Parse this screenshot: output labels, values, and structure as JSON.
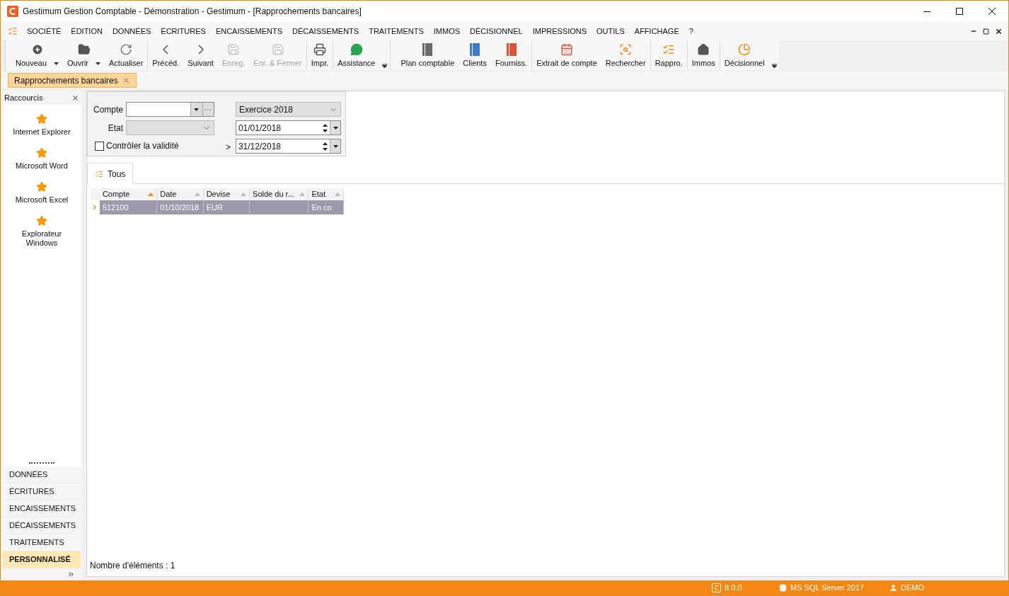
{
  "window": {
    "title": "Gestimum Gestion Comptable - Démonstration - Gestimum - [Rapprochements bancaires]"
  },
  "menu": [
    "SOCIÉTÉ",
    "ÉDITION",
    "DONNÉES",
    "ÉCRITURES",
    "ENCAISSEMENTS",
    "DÉCAISSEMENTS",
    "TRAITEMENTS",
    "IMMOS",
    "DÉCISIONNEL",
    "IMPRESSIONS",
    "OUTILS",
    "AFFICHAGE",
    "?"
  ],
  "toolbars": [
    {
      "groups": [
        [
          {
            "label": "Nouveau",
            "kind": "plus",
            "disabled": false,
            "dropdown": true
          },
          {
            "label": "Ouvrir",
            "kind": "folder",
            "disabled": false,
            "dropdown": true
          },
          {
            "label": "Actualiser",
            "kind": "refresh",
            "disabled": false,
            "dropdown": false
          }
        ],
        [
          {
            "label": "Précéd.",
            "kind": "prev",
            "disabled": false,
            "dropdown": false
          },
          {
            "label": "Suivant",
            "kind": "next",
            "disabled": false,
            "dropdown": false
          },
          {
            "label": "Enreg.",
            "kind": "save",
            "disabled": true,
            "dropdown": false
          },
          {
            "label": "Enr. & Fermer",
            "kind": "saveclose",
            "disabled": true,
            "dropdown": false
          }
        ],
        [
          {
            "label": "Impr.",
            "kind": "print",
            "disabled": false,
            "dropdown": false
          }
        ],
        [
          {
            "label": "Assistance",
            "kind": "chat",
            "disabled": false,
            "dropdown": false
          }
        ]
      ]
    },
    {
      "groups": [
        [
          {
            "label": "Plan comptable",
            "kind": "book-gray",
            "disabled": false,
            "dropdown": false
          },
          {
            "label": "Clients",
            "kind": "book-blue",
            "disabled": false,
            "dropdown": false
          },
          {
            "label": "Fourniss.",
            "kind": "book-red",
            "disabled": false,
            "dropdown": false
          }
        ],
        [
          {
            "label": "Extrait de compte",
            "kind": "calendar",
            "disabled": false,
            "dropdown": false
          },
          {
            "label": "Rechercher",
            "kind": "search",
            "disabled": false,
            "dropdown": false
          }
        ],
        [
          {
            "label": "Rappro.",
            "kind": "check",
            "disabled": false,
            "dropdown": false
          }
        ],
        [
          {
            "label": "Immos",
            "kind": "home",
            "disabled": false,
            "dropdown": false
          }
        ],
        [
          {
            "label": "Décisionnel",
            "kind": "pie",
            "disabled": false,
            "dropdown": false
          }
        ]
      ]
    }
  ],
  "doc_tabs": [
    {
      "label": "Rapprochements bancaires",
      "selected": true
    }
  ],
  "sidebar": {
    "title": "Raccourcis",
    "shortcuts": [
      "Internet Explorer",
      "Microsoft Word",
      "Microsoft Excel",
      "Explorateur Windows"
    ],
    "sections": [
      {
        "label": "DONNÉES",
        "selected": false
      },
      {
        "label": "ÉCRITURES",
        "selected": false
      },
      {
        "label": "ENCAISSEMENTS",
        "selected": false
      },
      {
        "label": "DÉCAISSEMENTS",
        "selected": false
      },
      {
        "label": "TRAITEMENTS",
        "selected": false
      },
      {
        "label": "PERSONNALISÉ",
        "selected": true
      }
    ]
  },
  "filter": {
    "compte_label": "Compte",
    "etat_label": "Etat",
    "check": {
      "label": "Contrôler la validité",
      "checked": false
    },
    "exercice": "Exercice 2018",
    "date_from": "01/01/2018",
    "date_to_prefix": ">",
    "date_to": "31/12/2018"
  },
  "view_tabs": [
    {
      "label": "Tous",
      "selected": true
    }
  ],
  "table": {
    "columns": [
      {
        "label": "Compte",
        "sorted": true
      },
      {
        "label": "Date",
        "sorted": false
      },
      {
        "label": "Devise",
        "sorted": false
      },
      {
        "label": "Solde du r...",
        "sorted": false
      },
      {
        "label": "Etat",
        "sorted": false
      }
    ],
    "rows": [
      {
        "cells": [
          "512100",
          "01/10/2018",
          "EUR",
          null,
          "En co"
        ],
        "selected": true
      }
    ]
  },
  "footer": "Nombre d'éléments : 1",
  "status_bar": {
    "version": "8.0.0",
    "server": "MS SQL Server 2017",
    "user": "DEMO"
  }
}
